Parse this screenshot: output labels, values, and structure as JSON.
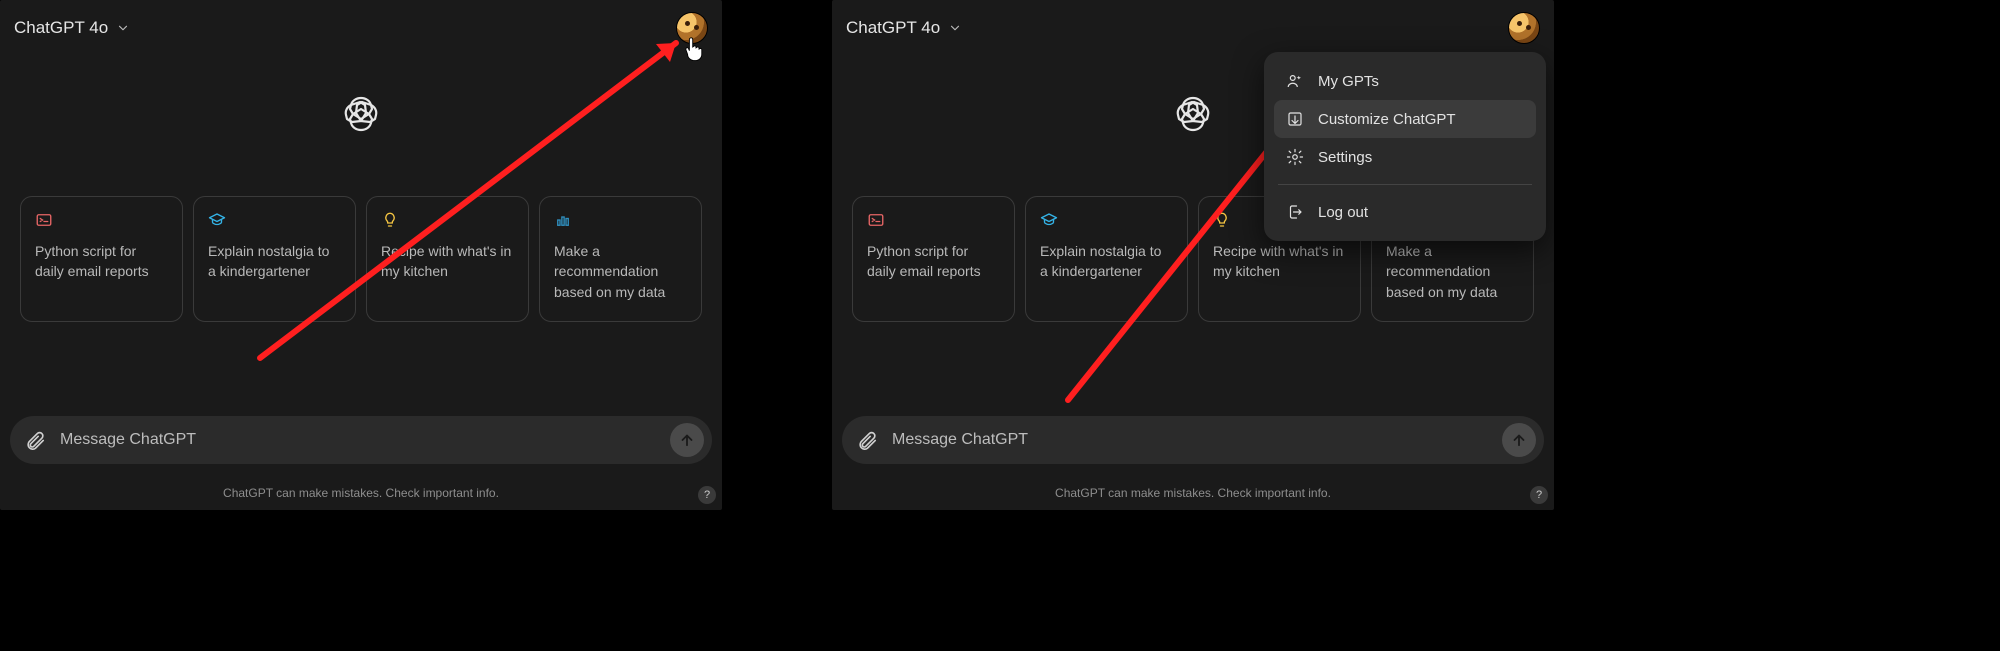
{
  "model_label": "ChatGPT 4o",
  "suggestions": [
    {
      "icon": "terminal",
      "text": "Python script for daily email reports"
    },
    {
      "icon": "graduation",
      "text": "Explain nostalgia to a kindergartener"
    },
    {
      "icon": "bulb",
      "text": "Recipe with what's in my kitchen"
    },
    {
      "icon": "chart",
      "text": "Make a recommendation based on my data"
    }
  ],
  "input_placeholder": "Message ChatGPT",
  "footer": "ChatGPT can make mistakes. Check important info.",
  "help_label": "?",
  "menu": {
    "my_gpts": "My GPTs",
    "customize": "Customize ChatGPT",
    "settings": "Settings",
    "logout": "Log out"
  }
}
